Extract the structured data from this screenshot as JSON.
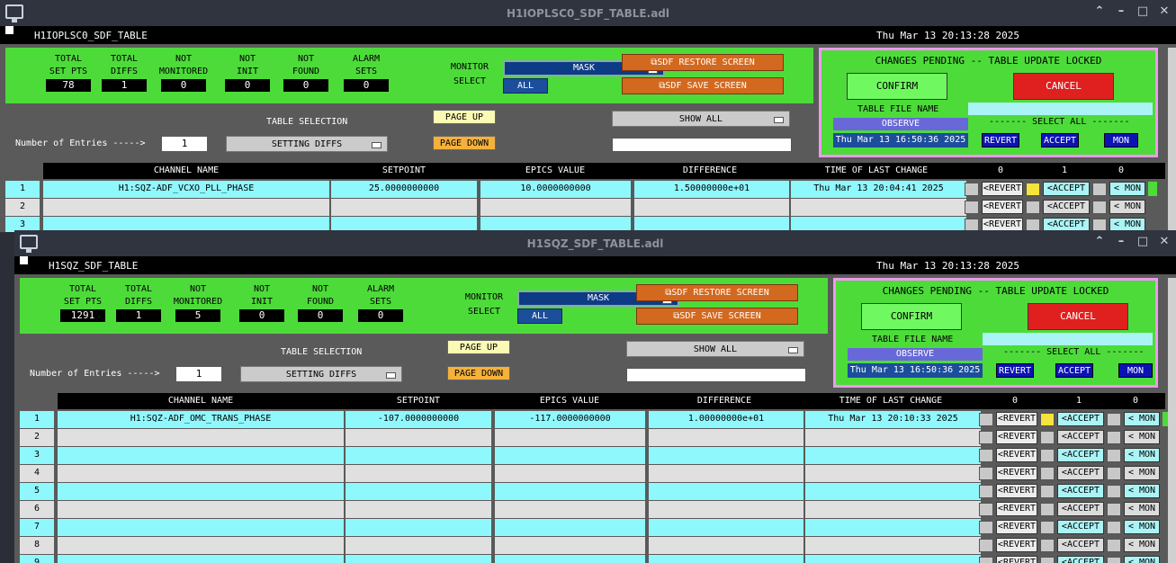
{
  "win1": {
    "title": "H1IOPLSC0_SDF_TABLE.adl",
    "model": "H1IOPLSC0_SDF_TABLE",
    "datetime": "Thu Mar 13 20:13:28 2025",
    "stats": [
      {
        "l1": "TOTAL",
        "l2": "SET PTS",
        "value": "78"
      },
      {
        "l1": "TOTAL",
        "l2": "DIFFS",
        "value": "1"
      },
      {
        "l1": "NOT",
        "l2": "MONITORED",
        "value": "0"
      },
      {
        "l1": "NOT",
        "l2": "INIT",
        "value": "0"
      },
      {
        "l1": "NOT",
        "l2": "FOUND",
        "value": "0"
      },
      {
        "l1": "ALARM",
        "l2": "SETS",
        "value": "0"
      }
    ],
    "entries": "1",
    "sdf_date": "Thu Mar 13 16:50:36 2025",
    "rows": [
      {
        "n": "1",
        "channel": "H1:SQZ-ADF_VCXO_PLL_PHASE",
        "setpoint": "25.0000000000",
        "epics": "10.0000000000",
        "diff": "1.50000000e+01",
        "time": "Thu Mar 13 20:04:41 2025"
      },
      {
        "n": "2",
        "channel": "",
        "setpoint": "",
        "epics": "",
        "diff": "",
        "time": ""
      },
      {
        "n": "3",
        "channel": "",
        "setpoint": "",
        "epics": "",
        "diff": "",
        "time": ""
      }
    ]
  },
  "win2": {
    "title": "H1SQZ_SDF_TABLE.adl",
    "model": "H1SQZ_SDF_TABLE",
    "datetime": "Thu Mar 13 20:13:28 2025",
    "stats": [
      {
        "l1": "TOTAL",
        "l2": "SET PTS",
        "value": "1291"
      },
      {
        "l1": "TOTAL",
        "l2": "DIFFS",
        "value": "1"
      },
      {
        "l1": "NOT",
        "l2": "MONITORED",
        "value": "5"
      },
      {
        "l1": "NOT",
        "l2": "INIT",
        "value": "0"
      },
      {
        "l1": "NOT",
        "l2": "FOUND",
        "value": "0"
      },
      {
        "l1": "ALARM",
        "l2": "SETS",
        "value": "0"
      }
    ],
    "entries": "1",
    "sdf_date": "Thu Mar 13 16:50:36 2025",
    "rows": [
      {
        "n": "1",
        "channel": "H1:SQZ-ADF_OMC_TRANS_PHASE",
        "setpoint": "-107.0000000000",
        "epics": "-117.0000000000",
        "diff": "1.00000000e+01",
        "time": "Thu Mar 13 20:10:33 2025"
      },
      {
        "n": "2",
        "channel": "",
        "setpoint": "",
        "epics": "",
        "diff": "",
        "time": ""
      },
      {
        "n": "3",
        "channel": "",
        "setpoint": "",
        "epics": "",
        "diff": "",
        "time": ""
      },
      {
        "n": "4",
        "channel": "",
        "setpoint": "",
        "epics": "",
        "diff": "",
        "time": ""
      },
      {
        "n": "5",
        "channel": "",
        "setpoint": "",
        "epics": "",
        "diff": "",
        "time": ""
      },
      {
        "n": "6",
        "channel": "",
        "setpoint": "",
        "epics": "",
        "diff": "",
        "time": ""
      },
      {
        "n": "7",
        "channel": "",
        "setpoint": "",
        "epics": "",
        "diff": "",
        "time": ""
      },
      {
        "n": "8",
        "channel": "",
        "setpoint": "",
        "epics": "",
        "diff": "",
        "time": ""
      },
      {
        "n": "9",
        "channel": "",
        "setpoint": "",
        "epics": "",
        "diff": "",
        "time": ""
      }
    ]
  },
  "labels": {
    "monitor_select_1": "MONITOR",
    "monitor_select_2": "SELECT",
    "mask": "MASK",
    "all": "ALL",
    "sdf_restore": "SDF RESTORE SCREEN",
    "sdf_save": "SDF SAVE SCREEN",
    "changes_pending": "CHANGES PENDING -- TABLE UPDATE LOCKED",
    "confirm": "CONFIRM",
    "cancel": "CANCEL",
    "table_file_name": "TABLE FILE NAME",
    "observe": "OBSERVE",
    "select_all": "------- SELECT ALL -------",
    "revert": "REVERT",
    "accept": "ACCEPT",
    "mon": "MON",
    "table_selection": "TABLE SELECTION",
    "page_up": "PAGE UP",
    "page_down": "PAGE DOWN",
    "show_all": "SHOW ALL",
    "setting_diffs": "SETTING DIFFS",
    "number_of_entries": "Number of Entries ----->",
    "col_channel": "CHANNEL NAME",
    "col_setpoint": "SETPOINT",
    "col_epics": "EPICS VALUE",
    "col_difference": "DIFFERENCE",
    "col_time": "TIME OF LAST CHANGE",
    "col_0a": "0",
    "col_1": "1",
    "col_0b": "0",
    "row_revert": "<REVERT",
    "row_accept": "<ACCEPT",
    "row_mon": "< MON"
  },
  "colors": {
    "green": "#4ddb3a",
    "cyan": "#8ff8fd",
    "pink": "#ee99ee",
    "orange": "#d2691e",
    "red": "#e0201e"
  }
}
